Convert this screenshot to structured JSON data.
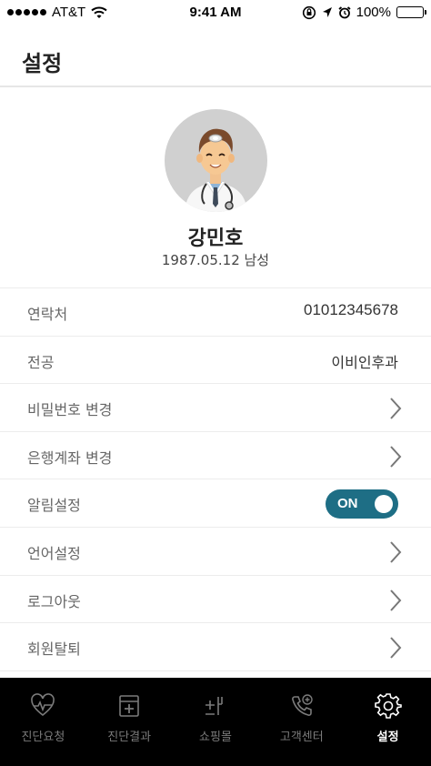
{
  "status_bar": {
    "carrier": "AT&T",
    "time": "9:41 AM",
    "battery": "100%",
    "battery_level": 1.0
  },
  "header": {
    "title": "설정"
  },
  "profile": {
    "name": "강민호",
    "details": "1987.05.12 남성"
  },
  "settings": {
    "rows": [
      {
        "label": "연락처",
        "value": "01012345678"
      },
      {
        "label": "전공",
        "value": "이비인후과"
      },
      {
        "label": "비밀번호 변경"
      },
      {
        "label": "은행계좌 변경"
      },
      {
        "label": "알림설정",
        "toggle_label": "ON",
        "toggle_on": true
      },
      {
        "label": "언어설정"
      },
      {
        "label": "로그아웃"
      },
      {
        "label": "회원탈퇴"
      }
    ]
  },
  "tabbar": {
    "tabs": [
      {
        "label": "진단요청",
        "icon": "heart-pulse-icon"
      },
      {
        "label": "진단결과",
        "icon": "medical-chart-icon"
      },
      {
        "label": "쇼핑몰",
        "icon": "shopping-icon"
      },
      {
        "label": "고객센터",
        "icon": "phone-plus-icon"
      },
      {
        "label": "설정",
        "icon": "gear-icon",
        "active": true
      }
    ]
  },
  "colors": {
    "toggle_on": "#1e6e85",
    "tabbar_bg": "#000000",
    "tab_inactive": "#7b7b7b",
    "tab_active": "#ffffff"
  }
}
